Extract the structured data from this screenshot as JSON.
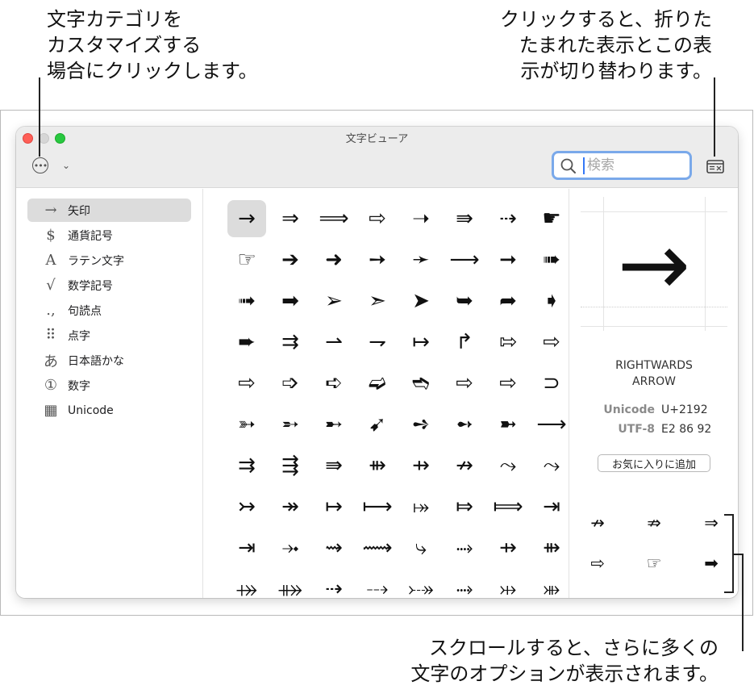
{
  "callouts": {
    "left": [
      "文字カテゴリを",
      "カスタマイズする",
      "場合にクリックします。"
    ],
    "right": [
      "クリックすると、折りた",
      "たまれた表示とこの表",
      "示が切り替わります。"
    ],
    "bottom": [
      "スクロールすると、さらに多くの",
      "文字のオプションが表示されます。"
    ]
  },
  "window": {
    "title": "文字ビューア",
    "more_icon": "ellipsis-circle-icon",
    "search_placeholder": "検索",
    "search_value": ""
  },
  "sidebar": {
    "items": [
      {
        "icon": "→",
        "label": "矢印",
        "selected": true
      },
      {
        "icon": "$",
        "label": "通貨記号"
      },
      {
        "icon": "A",
        "label": "ラテン文字"
      },
      {
        "icon": "√",
        "label": "数学記号"
      },
      {
        "icon": ".,",
        "label": "句読点"
      },
      {
        "icon": "⠿",
        "label": "点字"
      },
      {
        "icon": "あ",
        "label": "日本語かな"
      },
      {
        "icon": "①",
        "label": "数字"
      },
      {
        "icon": "▦",
        "label": "Unicode"
      }
    ]
  },
  "grid": {
    "selected_index": 0,
    "rows": [
      [
        "→",
        "⇒",
        "⟹",
        "⇨",
        "➝",
        "⇛",
        "⇢",
        "☛"
      ],
      [
        "☞",
        "➔",
        "➜",
        "➙",
        "➛",
        "⟶",
        "➞",
        "➠"
      ],
      [
        "➟",
        "➡",
        "➢",
        "➣",
        "➤",
        "➥",
        "➦",
        "➧"
      ],
      [
        "➨",
        "⇉",
        "⇀",
        "⇁",
        "↦",
        "↱",
        "⇰",
        "⇨"
      ],
      [
        "⇨",
        "➩",
        "➪",
        "➫",
        "➬",
        "⇨",
        "⇨",
        "⊃"
      ],
      [
        "➳",
        "➵",
        "➸",
        "➹",
        "➺",
        "➻",
        "➼",
        "⟶"
      ],
      [
        "⇉",
        "⇶",
        "⇛",
        "⇻",
        "⇸",
        "↛",
        "⤳",
        "⤳"
      ],
      [
        "↣",
        "↠",
        "↦",
        "⟼",
        "⤅",
        "⤇",
        "⟾",
        "⇥"
      ],
      [
        "⇥",
        "⤞",
        "⇝",
        "⟿",
        "⤷",
        "⤑",
        "⇸",
        "⇻"
      ],
      [
        "⤀",
        "⤁",
        "⇢",
        "⤏",
        "⤐",
        "⤑",
        "⤔",
        "⤕"
      ]
    ]
  },
  "detail": {
    "char": "→",
    "name_lines": [
      "RIGHTWARDS",
      "ARROW"
    ],
    "unicode_label": "Unicode",
    "unicode_value": "U+2192",
    "utf8_label": "UTF-8",
    "utf8_value": "E2 86 92",
    "favorites_button": "お気に入りに追加",
    "related": [
      "↛",
      "⇏",
      "⇒",
      "⇨",
      "☞",
      "➡",
      "⊖",
      "↚"
    ]
  }
}
